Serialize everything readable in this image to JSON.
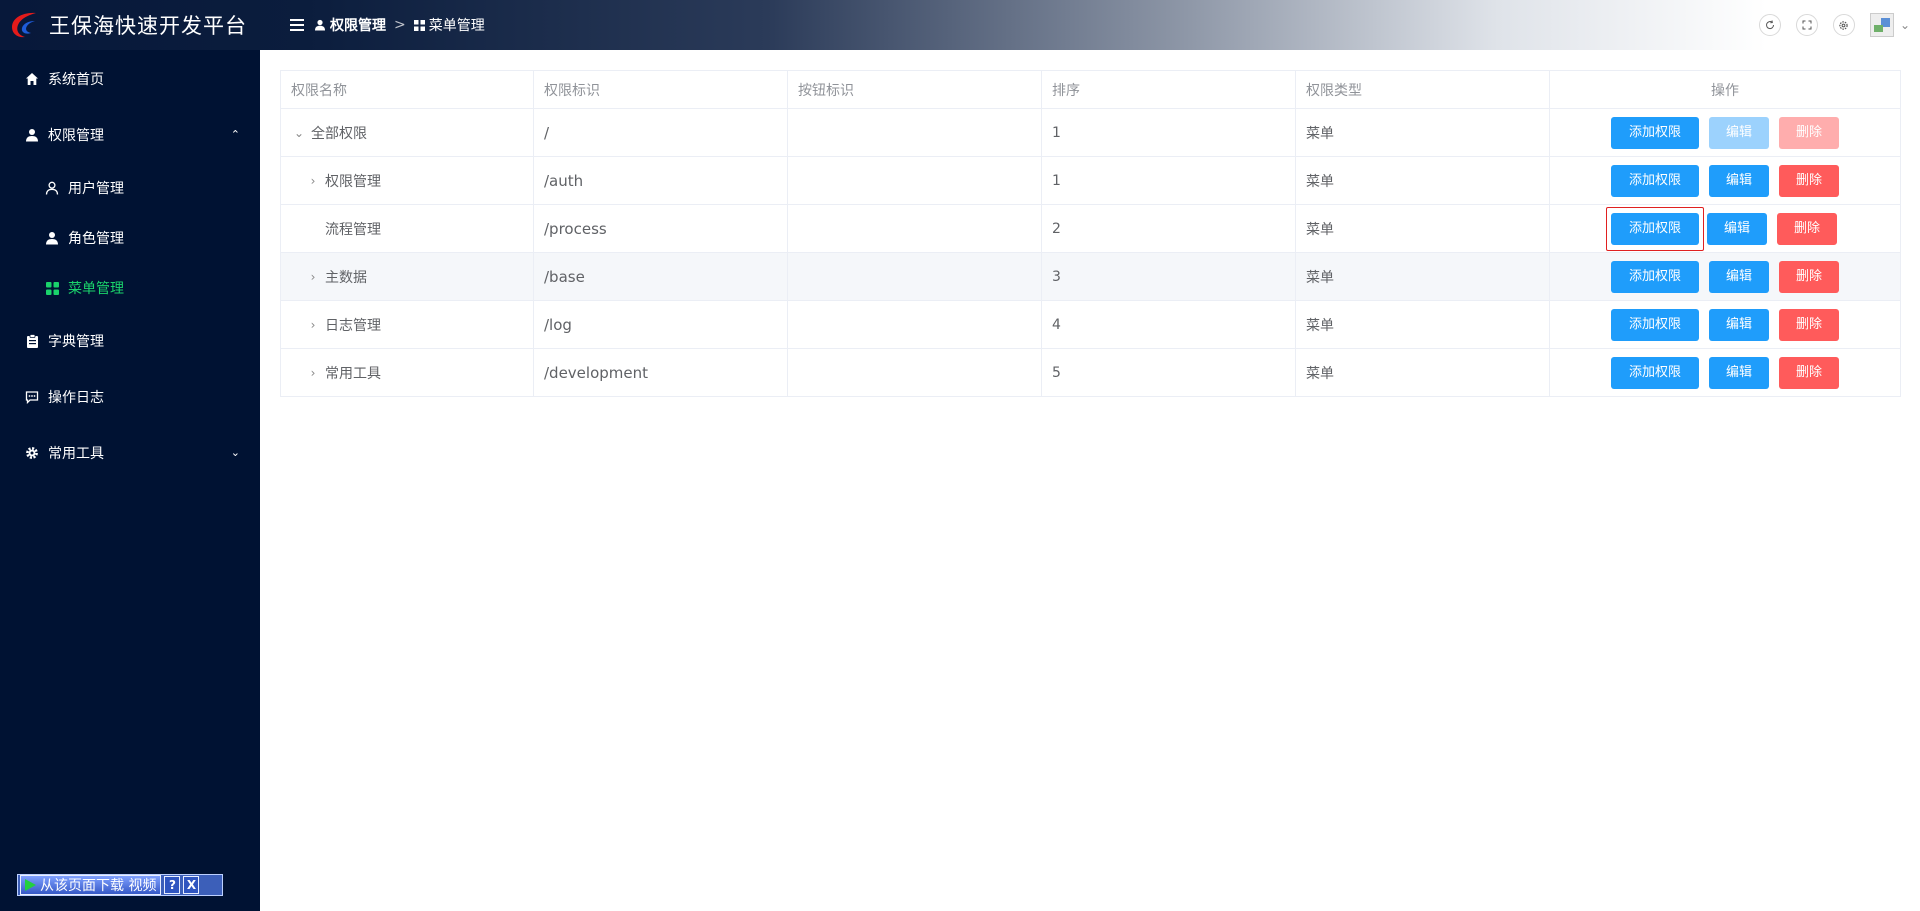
{
  "app": {
    "title": "王保海快速开发平台"
  },
  "breadcrumb": [
    {
      "label": "权限管理",
      "icon": "user-icon"
    },
    {
      "label": "菜单管理",
      "icon": "grid-icon"
    }
  ],
  "topbar": {
    "icons": [
      "refresh-icon",
      "fullscreen-icon",
      "settings-icon",
      "avatar-image",
      "chevron-down-icon"
    ]
  },
  "sidebar": {
    "items": [
      {
        "label": "系统首页",
        "icon": "home-icon"
      },
      {
        "label": "权限管理",
        "icon": "user-icon",
        "expanded": true,
        "children": [
          {
            "label": "用户管理",
            "icon": "user-outline-icon"
          },
          {
            "label": "角色管理",
            "icon": "user-icon"
          },
          {
            "label": "菜单管理",
            "icon": "grid-icon",
            "active": true
          }
        ]
      },
      {
        "label": "字典管理",
        "icon": "clipboard-icon"
      },
      {
        "label": "操作日志",
        "icon": "chat-icon"
      },
      {
        "label": "常用工具",
        "icon": "gear-icon",
        "expanded": false
      }
    ],
    "download_bar": {
      "label": "从该页面下载 视频",
      "help": "?",
      "close": "X"
    }
  },
  "table": {
    "columns": [
      "权限名称",
      "权限标识",
      "按钮标识",
      "排序",
      "权限类型",
      "操作"
    ],
    "rows": [
      {
        "name": "全部权限",
        "path": "/",
        "button": "",
        "sort": "1",
        "type": "菜单",
        "expand": "down",
        "indent": 0,
        "edit_disabled": true,
        "del_disabled": true
      },
      {
        "name": "权限管理",
        "path": "/auth",
        "button": "",
        "sort": "1",
        "type": "菜单",
        "expand": "right",
        "indent": 1
      },
      {
        "name": "流程管理",
        "path": "/process",
        "button": "",
        "sort": "2",
        "type": "菜单",
        "expand": "none",
        "indent": 1,
        "focused": true
      },
      {
        "name": "主数据",
        "path": "/base",
        "button": "",
        "sort": "3",
        "type": "菜单",
        "expand": "right",
        "indent": 1,
        "highlighted": true
      },
      {
        "name": "日志管理",
        "path": "/log",
        "button": "",
        "sort": "4",
        "type": "菜单",
        "expand": "right",
        "indent": 1
      },
      {
        "name": "常用工具",
        "path": "/development",
        "button": "",
        "sort": "5",
        "type": "菜单",
        "expand": "right",
        "indent": 1
      }
    ],
    "actions": {
      "add": "添加权限",
      "edit": "编辑",
      "delete": "删除"
    }
  },
  "colors": {
    "sidebar_bg": "#001233",
    "active_menu": "#1ad36b",
    "primary": "#1f9dfb",
    "danger": "#ff5b5b",
    "focus": "#e02020"
  }
}
